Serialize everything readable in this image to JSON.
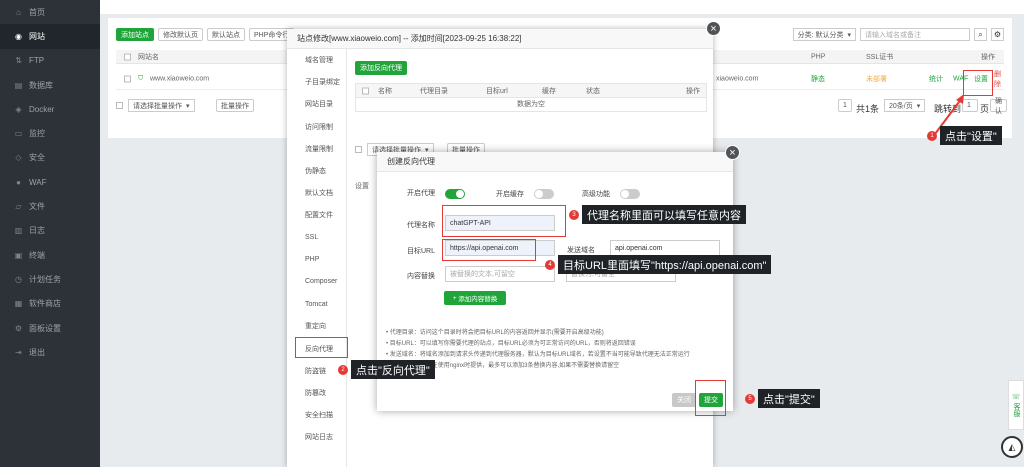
{
  "sidebar": {
    "items": [
      {
        "label": "首页",
        "icon": "home-icon",
        "glyph": "⌂"
      },
      {
        "label": "网站",
        "icon": "globe-icon",
        "glyph": "◉",
        "active": true
      },
      {
        "label": "FTP",
        "icon": "ftp-icon",
        "glyph": "⇅"
      },
      {
        "label": "数据库",
        "icon": "database-icon",
        "glyph": "▤"
      },
      {
        "label": "Docker",
        "icon": "docker-icon",
        "glyph": "◈"
      },
      {
        "label": "监控",
        "icon": "monitor-icon",
        "glyph": "▭"
      },
      {
        "label": "安全",
        "icon": "shield-icon",
        "glyph": "◇"
      },
      {
        "label": "WAF",
        "icon": "waf-icon",
        "glyph": "●"
      },
      {
        "label": "文件",
        "icon": "folder-icon",
        "glyph": "▱"
      },
      {
        "label": "日志",
        "icon": "log-icon",
        "glyph": "▥"
      },
      {
        "label": "终端",
        "icon": "terminal-icon",
        "glyph": "▣"
      },
      {
        "label": "计划任务",
        "icon": "clock-icon",
        "glyph": "◷"
      },
      {
        "label": "软件商店",
        "icon": "store-icon",
        "glyph": "▦"
      },
      {
        "label": "面板设置",
        "icon": "gear-icon",
        "glyph": "⚙"
      },
      {
        "label": "退出",
        "icon": "logout-icon",
        "glyph": "⇥"
      }
    ]
  },
  "sites": {
    "toolbar": {
      "add_site": "添加站点",
      "default_page": "修改默认页",
      "default_site": "默认站点",
      "php_cli": "PHP命令行",
      "category": "分类: 默认分类",
      "search_placeholder": "请输入域名或备注"
    },
    "headers": {
      "name": "网站名",
      "php": "PHP",
      "ssl": "SSL证书",
      "ops": "操作"
    },
    "row": {
      "name": "www.xiaoweio.com",
      "remark": "xiaoweio.com",
      "php": "静态",
      "ssl": "未部署",
      "op_stats": "统计",
      "op_waf": "WAF",
      "op_settings": "设置",
      "op_delete": "删除"
    },
    "batch_placeholder": "请选择批量操作",
    "batch_btn": "批量操作",
    "pagination": {
      "page": "1",
      "total": "共1条",
      "per_page": "20条/页",
      "jump": "跳转到",
      "jump_value": "1",
      "unit": "页",
      "confirm": "确认"
    }
  },
  "modal1": {
    "title": "站点修改[www.xiaoweio.com] -- 添加时间[2023-09-25 16:38:22]",
    "nav": [
      "域名管理",
      "子目录绑定",
      "网站目录",
      "访问限制",
      "流量限制",
      "伪静态",
      "默认文档",
      "配置文件",
      "SSL",
      "PHP",
      "Composer",
      "Tomcat",
      "重定向",
      "反向代理",
      "防盗链",
      "防篡改",
      "安全扫描",
      "网站日志"
    ],
    "add_proxy": "添加反向代理",
    "table_headers": [
      "名称",
      "代理目录",
      "目标url",
      "缓存",
      "状态",
      "操作"
    ],
    "empty": "数据为空",
    "batch_placeholder": "请选择批量操作",
    "batch_btn": "批量操作",
    "note_prefix": "设置"
  },
  "modal2": {
    "title": "创建反向代理",
    "enable_proxy": "开启代理",
    "enable_cache": "开启缓存",
    "advanced": "高级功能",
    "proxy_name_label": "代理名称",
    "proxy_name_value": "chatGPT-API",
    "target_url_label": "目标URL",
    "target_url_value": "https://api.openai.com",
    "send_domain_label": "发送域名",
    "send_domain_value": "api.openai.com",
    "replace_label": "内容替换",
    "replace_placeholder": "被替换的文本,可留空",
    "replace_to_placeholder": "替换为,可留空",
    "add_replace": "添加内容替换",
    "notes": [
      "代理目录：访问这个目录时将会把目标URL的内容返回并显示(需要开启高级功能)",
      "目标URL：可以填写你需要代理的站点，目标URL必须为可正常访问的URL，否则将返回错误",
      "发送域名：将域名添加到请求头传递到代理服务器，默认为目标URL域名，若设置不当可能导致代理无法正常运行",
      "内容替换：只能在使用nginx时提供，最多可以添加3条替换内容,如果不需要替换请留空"
    ],
    "close": "关闭",
    "submit": "提交"
  },
  "annotations": [
    {
      "num": "1",
      "text": "点击\"设置\""
    },
    {
      "num": "2",
      "text": "点击\"反向代理\""
    },
    {
      "num": "3",
      "text": "代理名称里面可以填写任意内容"
    },
    {
      "num": "4",
      "text": "目标URL里面填写\"https://api.openai.com\""
    },
    {
      "num": "5",
      "text": "点击\"提交\""
    }
  ],
  "widget": {
    "label": "客服"
  }
}
